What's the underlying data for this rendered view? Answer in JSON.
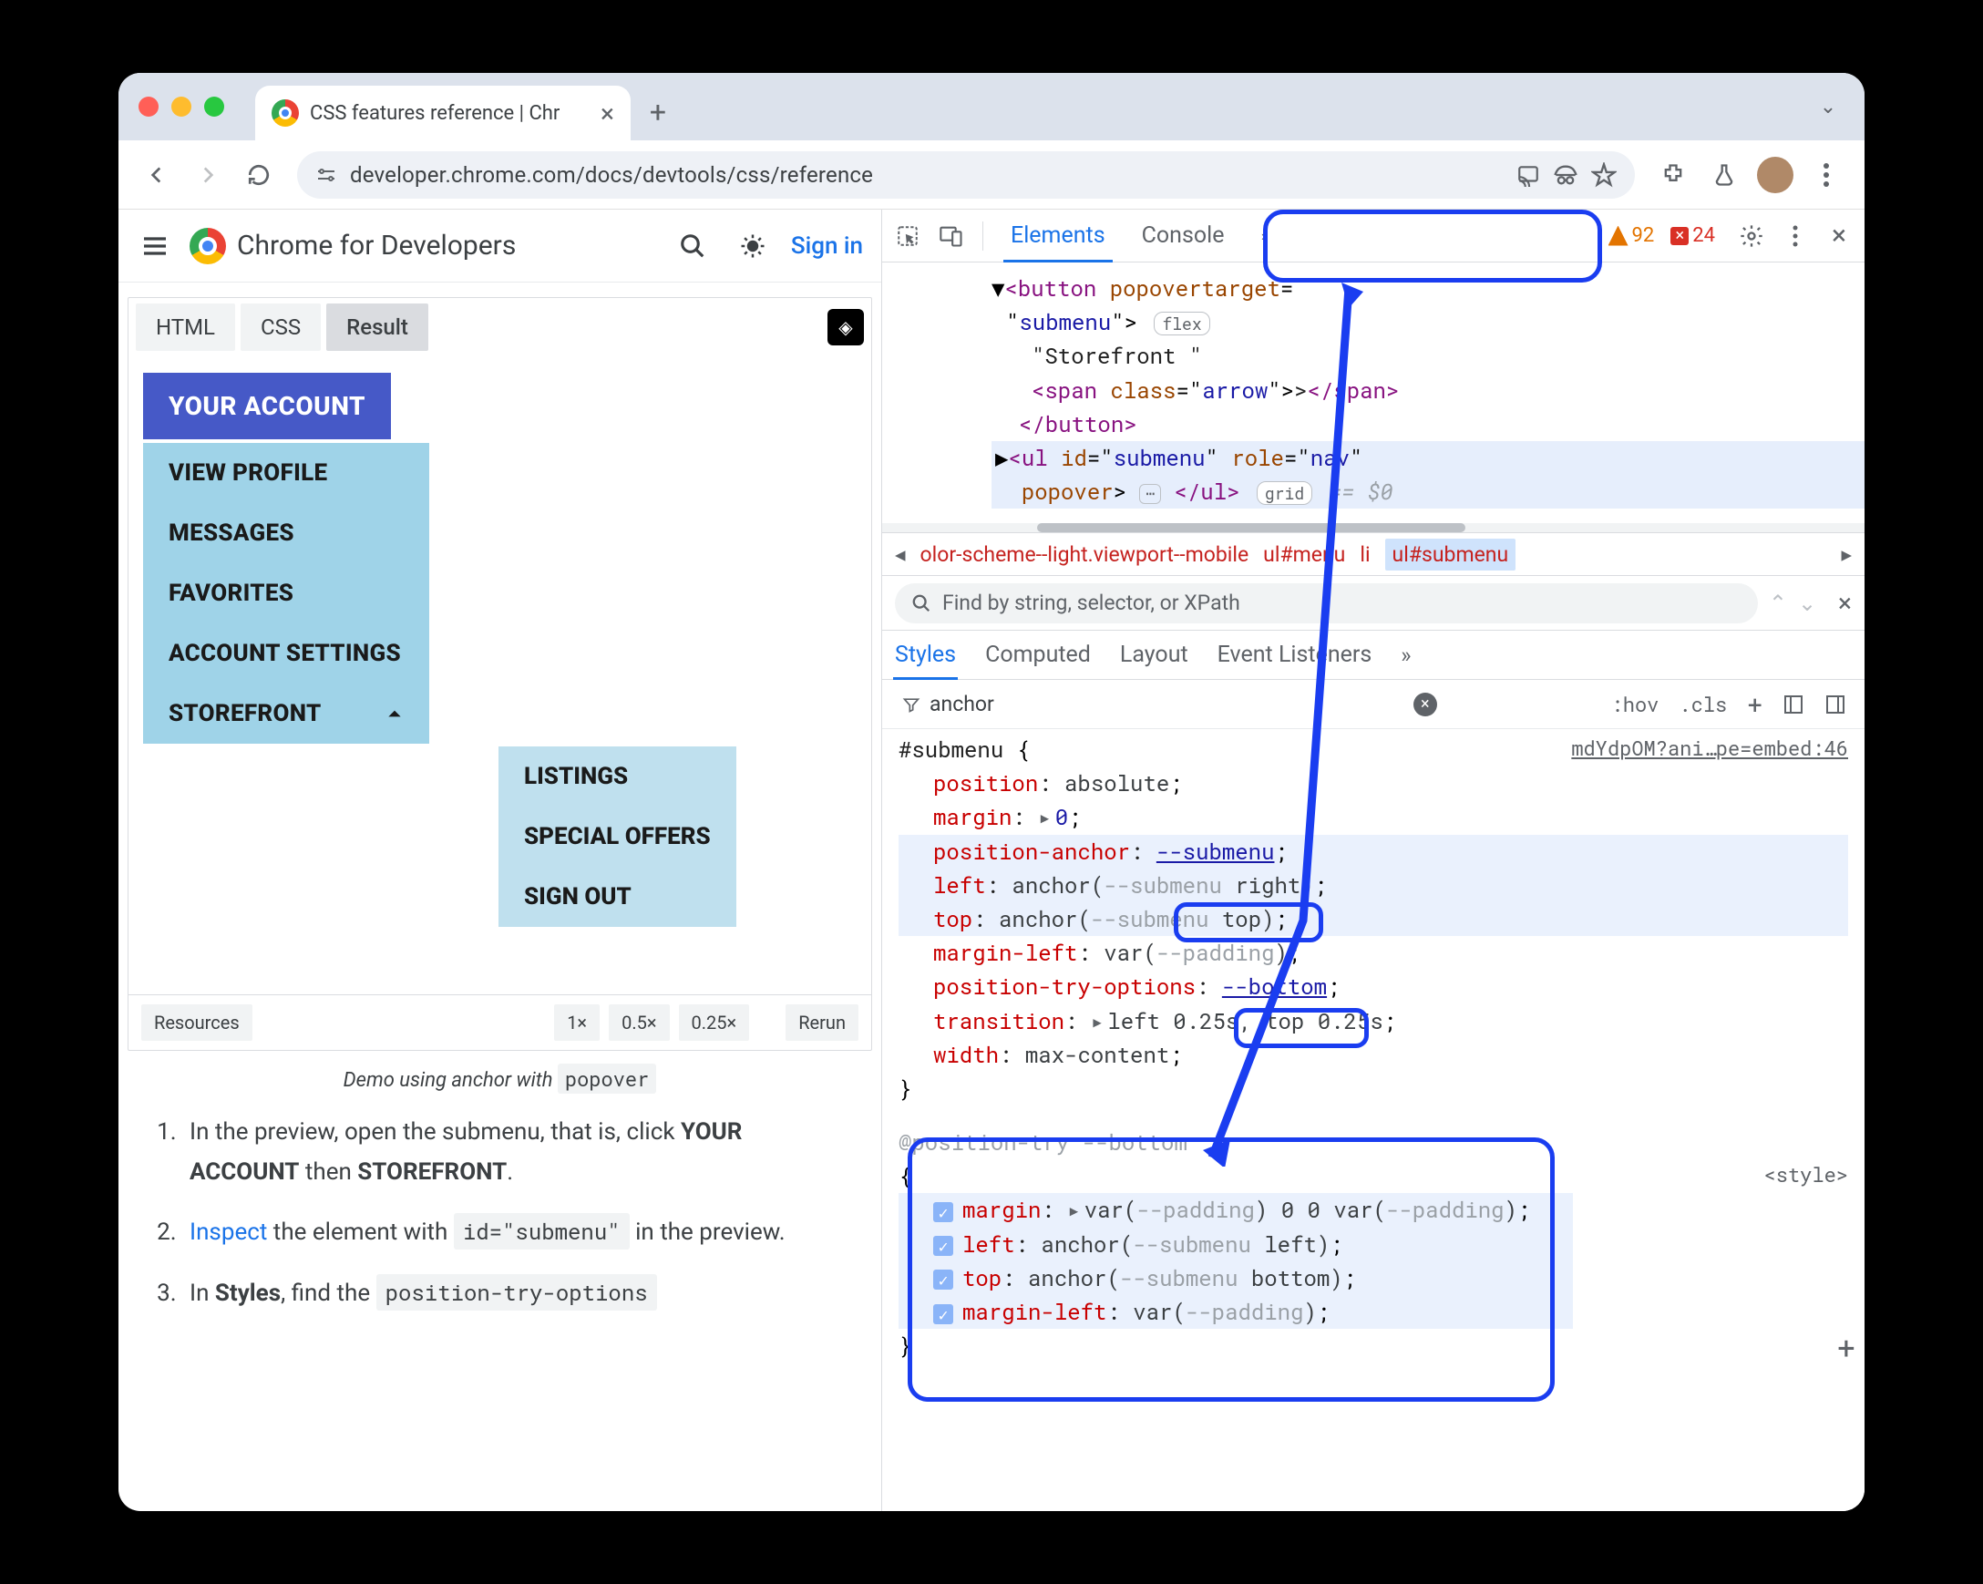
{
  "browser": {
    "tab_title": "CSS features reference  |  Chr",
    "url": "developer.chrome.com/docs/devtools/css/reference"
  },
  "page": {
    "brand": "Chrome for Developers",
    "signin": "Sign in",
    "embed_tabs": [
      "HTML",
      "CSS",
      "Result"
    ],
    "account_button": "YOUR ACCOUNT",
    "menu_items": [
      "VIEW PROFILE",
      "MESSAGES",
      "FAVORITES",
      "ACCOUNT SETTINGS",
      "STOREFRONT"
    ],
    "submenu_items": [
      "LISTINGS",
      "SPECIAL OFFERS",
      "SIGN OUT"
    ],
    "embed_footer": {
      "resources": "Resources",
      "z1": "1×",
      "z05": "0.5×",
      "z025": "0.25×",
      "rerun": "Rerun"
    },
    "caption_prefix": "Demo using anchor with ",
    "caption_code": "popover",
    "step1": "In the preview, open the submenu, that is, click ",
    "step1_b1": "YOUR ACCOUNT",
    "step1_mid": " then ",
    "step1_b2": "STOREFRONT",
    "step2_link": "Inspect",
    "step2_rest": " the element with ",
    "step2_code": "id=\"submenu\"",
    "step2_end": " in the preview.",
    "step3_a": "In ",
    "step3_b": "Styles",
    "step3_c": ", find the ",
    "step3_code": "position-try-options"
  },
  "devtools": {
    "tabs": {
      "elements": "Elements",
      "console": "Console"
    },
    "warn_count": "92",
    "err_count": "24",
    "dom": {
      "l1a": "<button",
      "l1b": "popovertarget",
      "l1c": "=",
      "l2a": "\"",
      "l2b": "submenu",
      "l2c": "\">",
      "l2_badge": "flex",
      "l3": "\"Storefront \"",
      "l4a": "<span",
      "l4b": "class",
      "l4c": "=\"",
      "l4d": "arrow",
      "l4e": "\">",
      "l4f": ">",
      "l4g": "</span>",
      "l5": "</button>",
      "l6a": "<ul",
      "l6b": "id",
      "l6c": "=\"",
      "l6d": "submenu",
      "l6e": "\"",
      "l6f": "role",
      "l6g": "=\"",
      "l6h": "nav",
      "l6i": "\"",
      "l7a": "popover",
      "l7b": ">",
      "l7c": "</ul>",
      "l7_badge": "grid",
      "l7_eq": " == $0"
    },
    "crumbs": {
      "c1": "olor-scheme--light.viewport--mobile",
      "c2": "ul#menu",
      "c3": "li",
      "c4": "ul#submenu"
    },
    "find_placeholder": "Find by string, selector, or XPath",
    "style_tabs": {
      "styles": "Styles",
      "computed": "Computed",
      "layout": "Layout",
      "listeners": "Event Listeners"
    },
    "filter_value": "anchor",
    "toolbar": {
      "hov": ":hov",
      "cls": ".cls"
    },
    "rules": {
      "source": "mdYdpOM?ani…pe=embed:46",
      "selector": "#submenu",
      "position": {
        "p": "position",
        "v": "absolute"
      },
      "margin": {
        "p": "margin",
        "v": "0"
      },
      "anchor": {
        "p": "position-anchor",
        "v": "--submenu"
      },
      "left": {
        "p": "left",
        "v_fn": "anchor(",
        "v_var": "--submenu",
        "v_rest": " right)"
      },
      "top": {
        "p": "top",
        "v_fn": "anchor(",
        "v_var": "--submenu",
        "v_rest": " top)"
      },
      "ml": {
        "p": "margin-left",
        "v_fn": "var(",
        "v_var": "--padding",
        "v_rest": ")"
      },
      "pto": {
        "p": "position-try-options",
        "v": "--bottom"
      },
      "transition": {
        "p": "transition",
        "v": "left 0.25s, top 0.25s"
      },
      "width": {
        "p": "width",
        "v": "max-content"
      },
      "at": "@position-try --bottom",
      "style_src": "<style>",
      "b_margin": {
        "p": "margin",
        "v_fn": "var(",
        "v_var": "--padding",
        "v_mid": ") 0 0 var(",
        "v_var2": "--padding",
        "v_end": ")"
      },
      "b_left": {
        "p": "left",
        "v_fn": "anchor(",
        "v_var": "--submenu",
        "v_rest": " left)"
      },
      "b_top": {
        "p": "top",
        "v_fn": "anchor(",
        "v_var": "--submenu",
        "v_rest": " bottom)"
      },
      "b_ml": {
        "p": "margin-left",
        "v_fn": "var(",
        "v_var": "--padding",
        "v_rest": ")"
      }
    }
  }
}
